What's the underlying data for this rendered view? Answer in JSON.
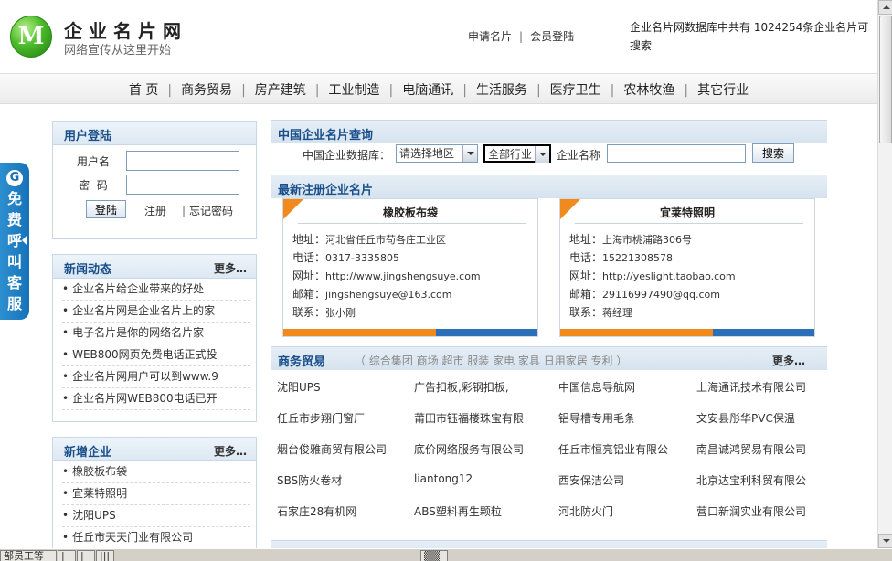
{
  "header": {
    "logo_letter": "M",
    "site_name": "企业名片网",
    "slogan": "网络宣传从这里开始",
    "apply_link": "申请名片",
    "login_link": "会员登陆",
    "separator": "|",
    "db_info": "企业名片网数据库中共有 1024254条企业名片可搜索"
  },
  "nav": {
    "separator": "|",
    "items": [
      "首 页",
      "商务贸易",
      "房产建筑",
      "工业制造",
      "电脑通讯",
      "生活服务",
      "医疗卫生",
      "农林牧渔",
      "其它行业"
    ]
  },
  "float_tab": {
    "g_letter": "G",
    "chars": [
      "免",
      "费",
      "呼",
      "叫",
      "客",
      "服"
    ]
  },
  "login": {
    "title": "用户登陆",
    "username_label": "用户名",
    "password_label": "密  码",
    "username_value": "",
    "password_value": "",
    "submit_label": "登陆",
    "register_label": "注册",
    "separator": "|",
    "forgot_label": "忘记密码"
  },
  "news": {
    "title": "新闻动态",
    "more": "更多…",
    "items": [
      "企业名片给企业带来的好处",
      "企业名片网是企业名片上的家",
      "电子名片是你的网络名片家",
      "WEB800网页免费电话正式投",
      "企业名片网用户可以到www.9",
      "企业名片网WEB800电话已开"
    ]
  },
  "new_companies": {
    "title": "新增企业",
    "more": "更多…",
    "items": [
      "橡胶板布袋",
      "宜莱特照明",
      "沈阳UPS",
      "任丘市天天门业有限公司"
    ]
  },
  "search": {
    "title": "中国企业名片查询",
    "db_label": "中国企业数据库：",
    "region_value": "请选择地区",
    "industry_value": "全部行业",
    "name_label": "企业名称",
    "name_value": "",
    "submit_label": "搜索"
  },
  "latest": {
    "title": "最新注册企业名片",
    "cards": [
      {
        "name": "橡胶板布袋",
        "rows": [
          {
            "key": "地址：",
            "val": "河北省任丘市苟各庄工业区"
          },
          {
            "key": "电话：",
            "val": "0317-3335805"
          },
          {
            "key": "网址：",
            "val": "http://www.jingshengsuye.com"
          },
          {
            "key": "邮箱：",
            "val": "jingshengsuye@163.com"
          },
          {
            "key": "联系：",
            "val": "张小刚"
          }
        ]
      },
      {
        "name": "宜莱特照明",
        "rows": [
          {
            "key": "地址：",
            "val": "上海市桃浦路306号"
          },
          {
            "key": "电话：",
            "val": "15221308578"
          },
          {
            "key": "网址：",
            "val": "http://yeslight.taobao.com"
          },
          {
            "key": "邮箱：",
            "val": "29116997490@qq.com"
          },
          {
            "key": "联系：",
            "val": "蒋经理"
          }
        ]
      }
    ]
  },
  "trade": {
    "title": "商务贸易",
    "categories": "（ 综合集团  商场  超市  服装  家电  家具  日用家居  专利 ）",
    "more": "更多…",
    "rows": [
      [
        "沈阳UPS",
        "广告扣板,彩钢扣板,",
        "中国信息导航网",
        "上海通讯技术有限公司"
      ],
      [
        "任丘市步翔门窗厂",
        "莆田市钰福楼珠宝有限",
        "铝导槽专用毛条",
        "文安县彤华PVC保温"
      ],
      [
        "烟台俊雅商贸有限公司",
        "底价网络服务有限公司",
        "任丘市恒亮铝业有限公",
        "南昌诚鸿贸易有限公司"
      ],
      [
        "SBS防火卷材",
        "liantong12",
        "西安保洁公司",
        "北京达宝利科贸有限公"
      ],
      [
        "石家庄28有机网",
        "ABS塑料再生颗粒",
        "河北防火门",
        "营口新润实业有限公司"
      ]
    ]
  },
  "taskbar": {
    "items": [
      "部员工等",
      "|",
      "|",
      "|||",
      "▒▒"
    ]
  }
}
